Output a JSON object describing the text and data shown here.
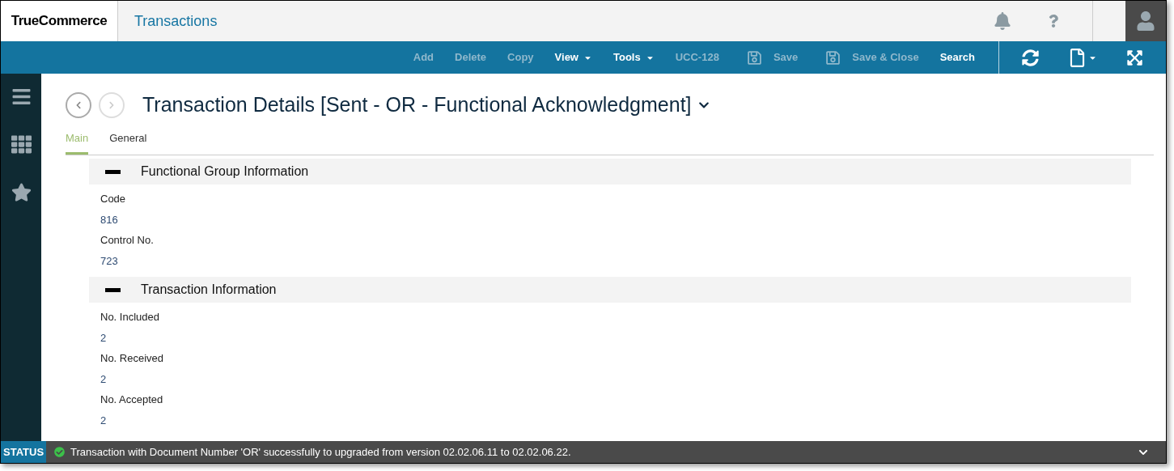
{
  "header": {
    "logo": "TrueCommerce",
    "title": "Transactions"
  },
  "toolbar": [
    {
      "label": "Add",
      "disabled": true
    },
    {
      "label": "Delete",
      "disabled": true
    },
    {
      "label": "Copy",
      "disabled": true
    },
    {
      "label": "View",
      "disabled": false,
      "kind": "dropdown"
    },
    {
      "label": "Tools",
      "disabled": false,
      "kind": "dropdown"
    },
    {
      "label": "UCC-128",
      "disabled": true
    },
    {
      "label": "Save",
      "disabled": true,
      "kind": "save"
    },
    {
      "label": "Save & Close",
      "disabled": true,
      "kind": "save"
    },
    {
      "label": "Search",
      "disabled": false
    }
  ],
  "page": {
    "title": "Transaction Details [Sent - OR - Functional Acknowledgment]",
    "back_disabled": false,
    "forward_disabled": true,
    "tabs": [
      {
        "label": "Main",
        "selected": true
      },
      {
        "label": "General",
        "selected": false
      }
    ],
    "sections": [
      {
        "title": "Functional Group Information",
        "expanded": true,
        "fields": [
          {
            "label": "Code",
            "value": "816"
          },
          {
            "label": "Control No.",
            "value": "723"
          }
        ]
      },
      {
        "title": "Transaction Information",
        "expanded": true,
        "fields": [
          {
            "label": "No. Included",
            "value": "2"
          },
          {
            "label": "No. Received",
            "value": "2"
          },
          {
            "label": "No. Accepted",
            "value": "2"
          }
        ]
      }
    ]
  },
  "status_bar": {
    "label": "STATUS",
    "message": "Transaction with Document Number 'OR' successfully to upgraded from version 02.02.06.11 to 02.02.06.22."
  }
}
